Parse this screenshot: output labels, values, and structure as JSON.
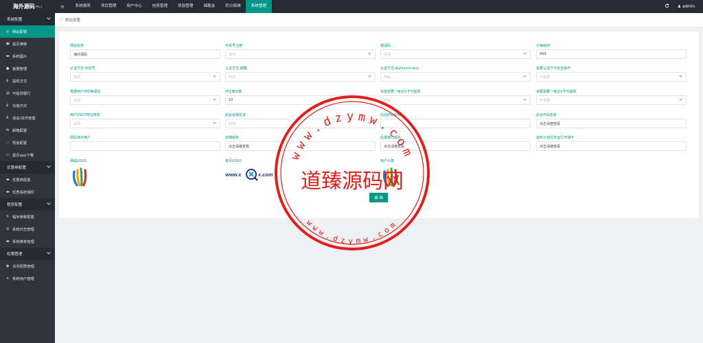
{
  "brand": {
    "name": "海外源码",
    "sup": "TPL.1"
  },
  "nav": {
    "menu_icon": "≡",
    "items": [
      "系统报表",
      "项目管理",
      "用户中心",
      "信息管理",
      "奖励管理",
      "储蓄金",
      "积分商城",
      "系统管理"
    ],
    "active_index": 7
  },
  "topbar": {
    "refresh_icon": "C",
    "admin_icon": "user-icon",
    "admin_label": "admin"
  },
  "sidebar": {
    "groups": [
      {
        "title": "系统配置",
        "items": [
          {
            "icon": "gear-icon",
            "glyph": "◎",
            "label": "网站配置",
            "active": true
          },
          {
            "icon": "popup-icon",
            "glyph": "▣",
            "label": "首页弹窗"
          },
          {
            "icon": "image-icon",
            "glyph": "▬",
            "label": "系统图片"
          },
          {
            "icon": "chat-icon",
            "glyph": "●",
            "label": "客服管理"
          },
          {
            "icon": "dollar-icon",
            "glyph": "$",
            "label": "提现方式"
          },
          {
            "icon": "table-icon",
            "glyph": "▤",
            "label": "可提现银行"
          },
          {
            "icon": "dollar-icon",
            "glyph": "$",
            "label": "充值方式"
          },
          {
            "icon": "font-icon",
            "glyph": "A",
            "label": "语言/货币管理"
          },
          {
            "icon": "mail-icon",
            "glyph": "✉",
            "label": "邮箱配置"
          },
          {
            "icon": "sms-icon",
            "glyph": "◌",
            "label": "短信配置"
          },
          {
            "icon": "download-icon",
            "glyph": "▭",
            "label": "首页app下载"
          }
        ]
      },
      {
        "title": "优惠券配置",
        "items": [
          {
            "icon": "image-icon",
            "glyph": "▬",
            "label": "优惠券配置"
          },
          {
            "icon": "card-icon",
            "glyph": "▬",
            "label": "优质系统授权"
          }
        ]
      },
      {
        "title": "程序配置",
        "items": [
          {
            "icon": "wrench-icon",
            "glyph": "✎",
            "label": "程序参数配置"
          },
          {
            "icon": "list-icon",
            "glyph": "☰",
            "label": "系统日志管理"
          },
          {
            "icon": "image-icon",
            "glyph": "▬",
            "label": "系统菜单管理"
          }
        ]
      },
      {
        "title": "权限管理",
        "items": [
          {
            "icon": "shield-icon",
            "glyph": "◉",
            "label": "访问权限管理"
          },
          {
            "icon": "user-icon",
            "glyph": "♙",
            "label": "系统用户管理"
          }
        ]
      }
    ]
  },
  "breadcrumb": {
    "label": "网站设置"
  },
  "form": {
    "fields": [
      {
        "label": "网站名称",
        "value": "海外源码",
        "kind": "text"
      },
      {
        "label": "手机号注册",
        "value": "关闭",
        "kind": "select"
      },
      {
        "label": "邀请码",
        "value": "关闭",
        "kind": "select"
      },
      {
        "label": "分销级别",
        "value": "999",
        "kind": "text"
      },
      {
        "label": "认证方式-手机号",
        "value": "关闭",
        "kind": "select"
      },
      {
        "label": "认证方式-邮箱",
        "value": "开启",
        "kind": "select"
      },
      {
        "label": "认证方式-Authenticator",
        "value": "开启",
        "kind": "select"
      },
      {
        "label": "需要认证才可安全操作",
        "value": "不需要",
        "kind": "select"
      },
      {
        "label": "根据用户IP切换语言",
        "value": "关闭",
        "kind": "select"
      },
      {
        "label": "IP注册次数",
        "value": "10",
        "kind": "text"
      },
      {
        "label": "充值需要一级达X才可提现",
        "value": "开启",
        "kind": "select"
      },
      {
        "label": "余额需要一级达X才可提现",
        "value": "不需要",
        "kind": "select"
      },
      {
        "label": "用户USDT地址校验",
        "value": "关闭",
        "kind": "select"
      },
      {
        "label": "后台谷歌验证",
        "value": "关闭",
        "kind": "select"
      },
      {
        "label": "后台IP白名单",
        "value": "",
        "kind": "text"
      },
      {
        "label": "后台IP白名单",
        "value": "点击请继查看",
        "kind": "text"
      },
      {
        "label": "网站演示用户",
        "value": "",
        "kind": "text"
      },
      {
        "label": "前端域名",
        "value": "点击请继查看",
        "kind": "text"
      },
      {
        "label": "后端接口域名",
        "value": "点击请继查看",
        "kind": "text"
      },
      {
        "label": "监听计划任务运行环境IP",
        "value": "点击请继查看",
        "kind": "text"
      }
    ],
    "logo_labels": [
      "网站LOGO",
      "首页LOGO",
      "用户头像"
    ],
    "logo2_text_a": "www.x",
    "logo2_text_b": "x.com",
    "submit_label": "编 辑"
  },
  "watermark": {
    "center": "道臻源码网",
    "ring_top": "www.dzymw.com",
    "ring_bottom": "www.dzymw.com"
  },
  "colors": {
    "accent": "#009688",
    "topbar": "#262b34",
    "sidebar": "#2f343e",
    "stamp": "#e0201b"
  }
}
